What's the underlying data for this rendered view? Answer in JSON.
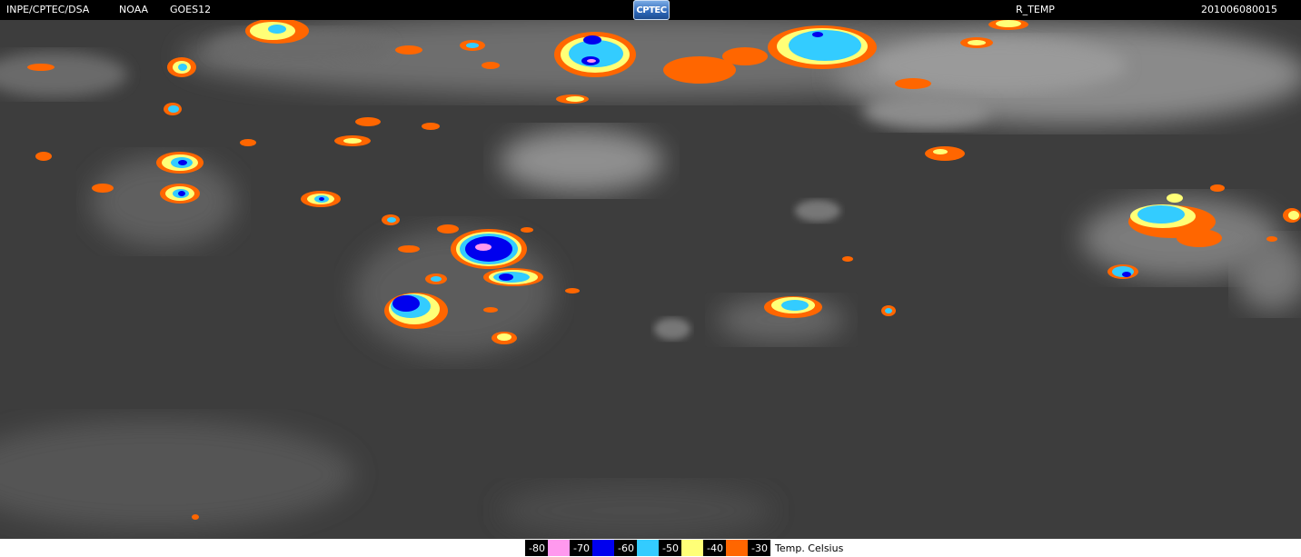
{
  "header": {
    "org": "INPE/CPTEC/DSA",
    "agency": "NOAA",
    "satellite": "GOES12",
    "logo_text": "CPTEC",
    "product": "R_TEMP",
    "timestamp": "201006080015"
  },
  "legend": {
    "units": "Temp. Celsius",
    "levels": [
      {
        "label": "-80",
        "color": "#ff99ee"
      },
      {
        "label": "-70",
        "color": "#0000ee"
      },
      {
        "label": "-60",
        "color": "#33ccff"
      },
      {
        "label": "-50",
        "color": "#ffff77"
      },
      {
        "label": "-40",
        "color": "#ff6600"
      },
      {
        "label": "-30",
        "color": "#000000"
      }
    ]
  },
  "palette": {
    "background": "#3d3d3d",
    "cloud_light": "#a8a8a8",
    "cloud_mid": "#7a7a7a"
  }
}
